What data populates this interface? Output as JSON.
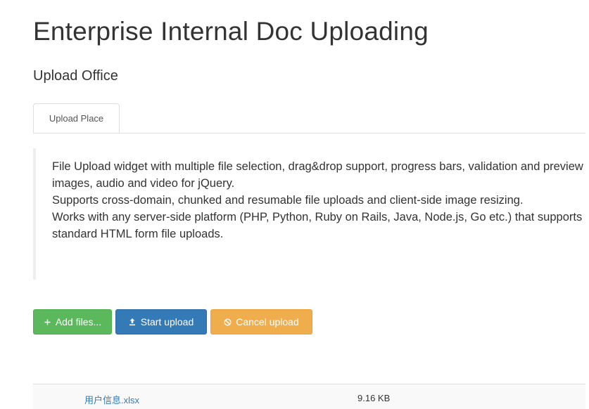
{
  "page": {
    "title": "Enterprise Internal Doc Uploading",
    "subtitle": "Upload Office"
  },
  "tabs": [
    {
      "label": "Upload Place",
      "active": true
    }
  ],
  "description": {
    "lines": [
      "File Upload widget with multiple file selection, drag&drop support, progress bars, validation and preview images, audio and video for jQuery.",
      "Supports cross-domain, chunked and resumable file uploads and client-side image resizing.",
      "Works with any server-side platform (PHP, Python, Ruby on Rails, Java, Node.js, Go etc.) that supports standard HTML form file uploads."
    ]
  },
  "toolbar": {
    "add_label": "Add files...",
    "add_icon": "plus-icon",
    "start_label": "Start upload",
    "start_icon": "upload-icon",
    "cancel_label": "Cancel upload",
    "cancel_icon": "ban-icon"
  },
  "files": [
    {
      "name": "用户信息.xlsx",
      "size": "9.16 KB"
    }
  ],
  "colors": {
    "success": "#5cb85c",
    "primary": "#337ab7",
    "warning": "#f0ad4e",
    "link": "#337ab7"
  }
}
